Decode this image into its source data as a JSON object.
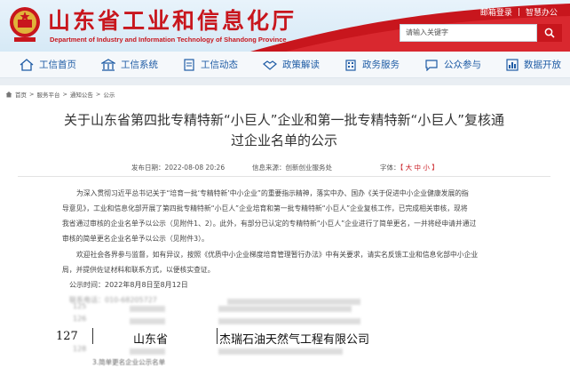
{
  "site": {
    "title": "山东省工业和信息化厅",
    "subtitle": "Department of Industry and Information Technology of Shandong Province",
    "top_links": [
      "邮箱登录",
      "智慧办公"
    ],
    "search_placeholder": "请输入关键字"
  },
  "nav": [
    {
      "label": "工信首页",
      "icon": "home-icon"
    },
    {
      "label": "工信系统",
      "icon": "bank-icon"
    },
    {
      "label": "工信动态",
      "icon": "document-icon"
    },
    {
      "label": "政策解读",
      "icon": "handshake-icon"
    },
    {
      "label": "政务服务",
      "icon": "building-icon"
    },
    {
      "label": "公众参与",
      "icon": "chat-icon"
    },
    {
      "label": "数据开放",
      "icon": "chart-icon"
    }
  ],
  "breadcrumb": [
    "首页",
    "服务平台",
    "通知公告",
    "公示"
  ],
  "article": {
    "title": "关于山东省第四批专精特新“小巨人”企业和第一批专精特新“小巨人”复核通过企业名单的公示",
    "date_label": "发布日期：",
    "date": "2022-08-08 20:26",
    "source_label": "信息来源：",
    "source": "创新创业服务处",
    "font_label": "字体：",
    "font_options": "【 大 中 小 】",
    "para1": [
      "为深入贯彻习近平总书记关于“培育一批‘专精特新’中小企业”的重要指示精神，落实中办、国办《关于促进中小企业健康发展的指",
      "导意见》，工业和信息化部开展了第四批专精特新“小巨人”企业培育和第一批专精特新“小巨人”企业复核工作，已完成相关审核，现将",
      "我省通过审核的企业名单予以公示（见附件1、2）。此外，有部分已认定的专精特新“小巨人”企业进行了简单更名，一并将经申请并通过",
      "审核的简单更名企业名单予以公示（见附件3）。"
    ],
    "para2": [
      "欢迎社会各界参与监督，如有异议，按照《优质中小企业梯度培育管理暂行办法》中有关要求，请实名反馈工业和信息化部中小企业",
      "局，并提供佐证材料和联系方式，以便核实查证。"
    ],
    "period_label": "公示时间：",
    "period": "2022年8月8日至8月12日",
    "contact": "联系电话：010-68205727"
  },
  "table": {
    "highlight": {
      "number": "127",
      "province": "山东省",
      "company": "杰瑞石油天然气工程有限公司"
    },
    "blurred_rows": [
      "125",
      "126",
      "128"
    ],
    "footer_note": "3.简单更名企业公示名单"
  }
}
